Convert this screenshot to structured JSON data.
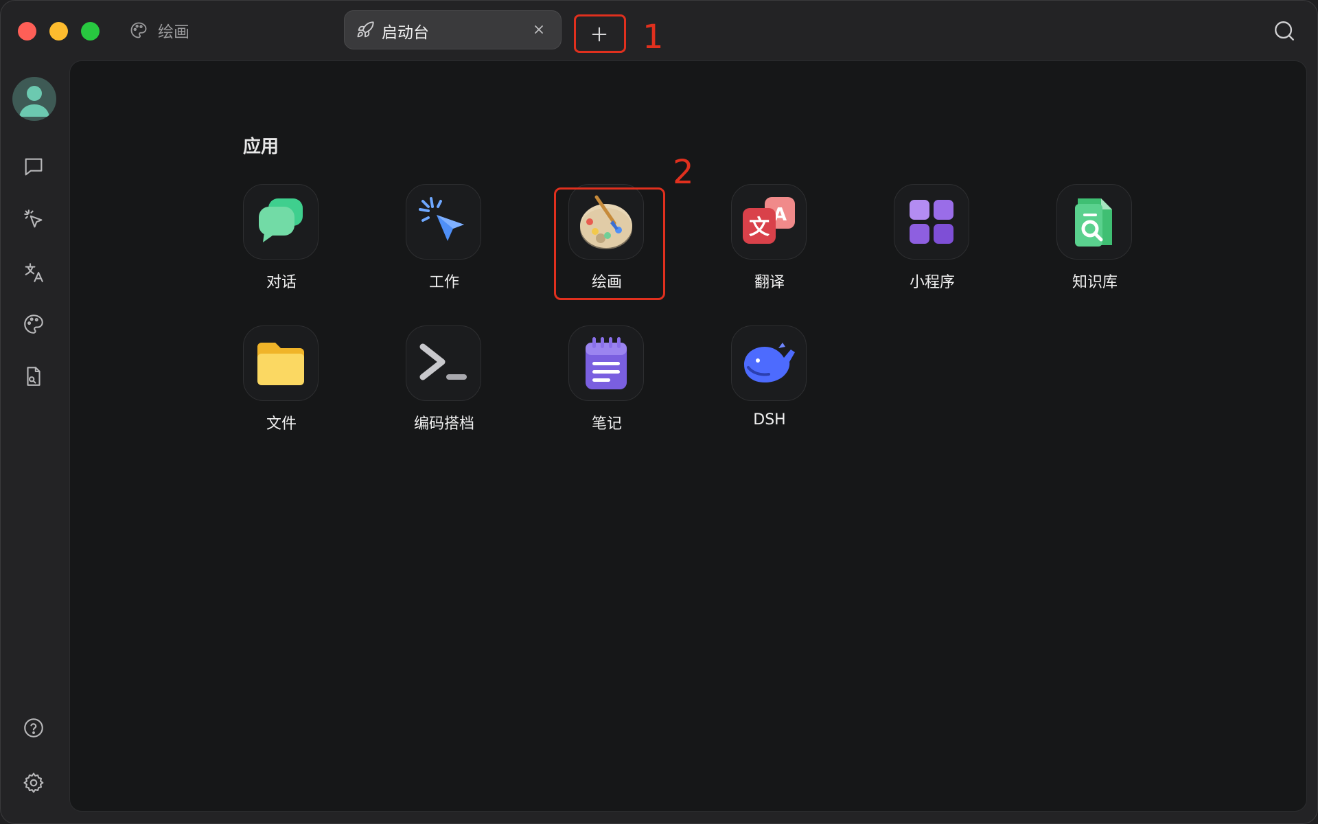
{
  "titlebar": {
    "current_app_label": "绘画",
    "tab_label": "启动台",
    "annotation_1": "1",
    "annotation_2": "2"
  },
  "sidebar": {
    "items": [
      {
        "name": "chat",
        "icon": "message-square-icon"
      },
      {
        "name": "agent",
        "icon": "pointer-sparkle-icon"
      },
      {
        "name": "translate",
        "icon": "translate-icon"
      },
      {
        "name": "paint",
        "icon": "palette-icon"
      },
      {
        "name": "files",
        "icon": "file-search-icon"
      }
    ],
    "bottom": [
      {
        "name": "help",
        "icon": "help-circle-icon"
      },
      {
        "name": "settings",
        "icon": "gear-icon"
      }
    ]
  },
  "main": {
    "section_title": "应用",
    "apps": [
      {
        "label": "对话",
        "icon": "chat-bubbles-icon"
      },
      {
        "label": "工作",
        "icon": "cursor-sparkle-icon"
      },
      {
        "label": "绘画",
        "icon": "palette-icon"
      },
      {
        "label": "翻译",
        "icon": "translate-cards-icon"
      },
      {
        "label": "小程序",
        "icon": "grid-apps-icon"
      },
      {
        "label": "知识库",
        "icon": "document-search-icon"
      },
      {
        "label": "文件",
        "icon": "folder-icon"
      },
      {
        "label": "编码搭档",
        "icon": "terminal-icon"
      },
      {
        "label": "笔记",
        "icon": "notepad-icon"
      },
      {
        "label": "DSH",
        "icon": "whale-icon"
      }
    ]
  },
  "colors": {
    "annotation_red": "#e0301e",
    "background": "#161718"
  }
}
